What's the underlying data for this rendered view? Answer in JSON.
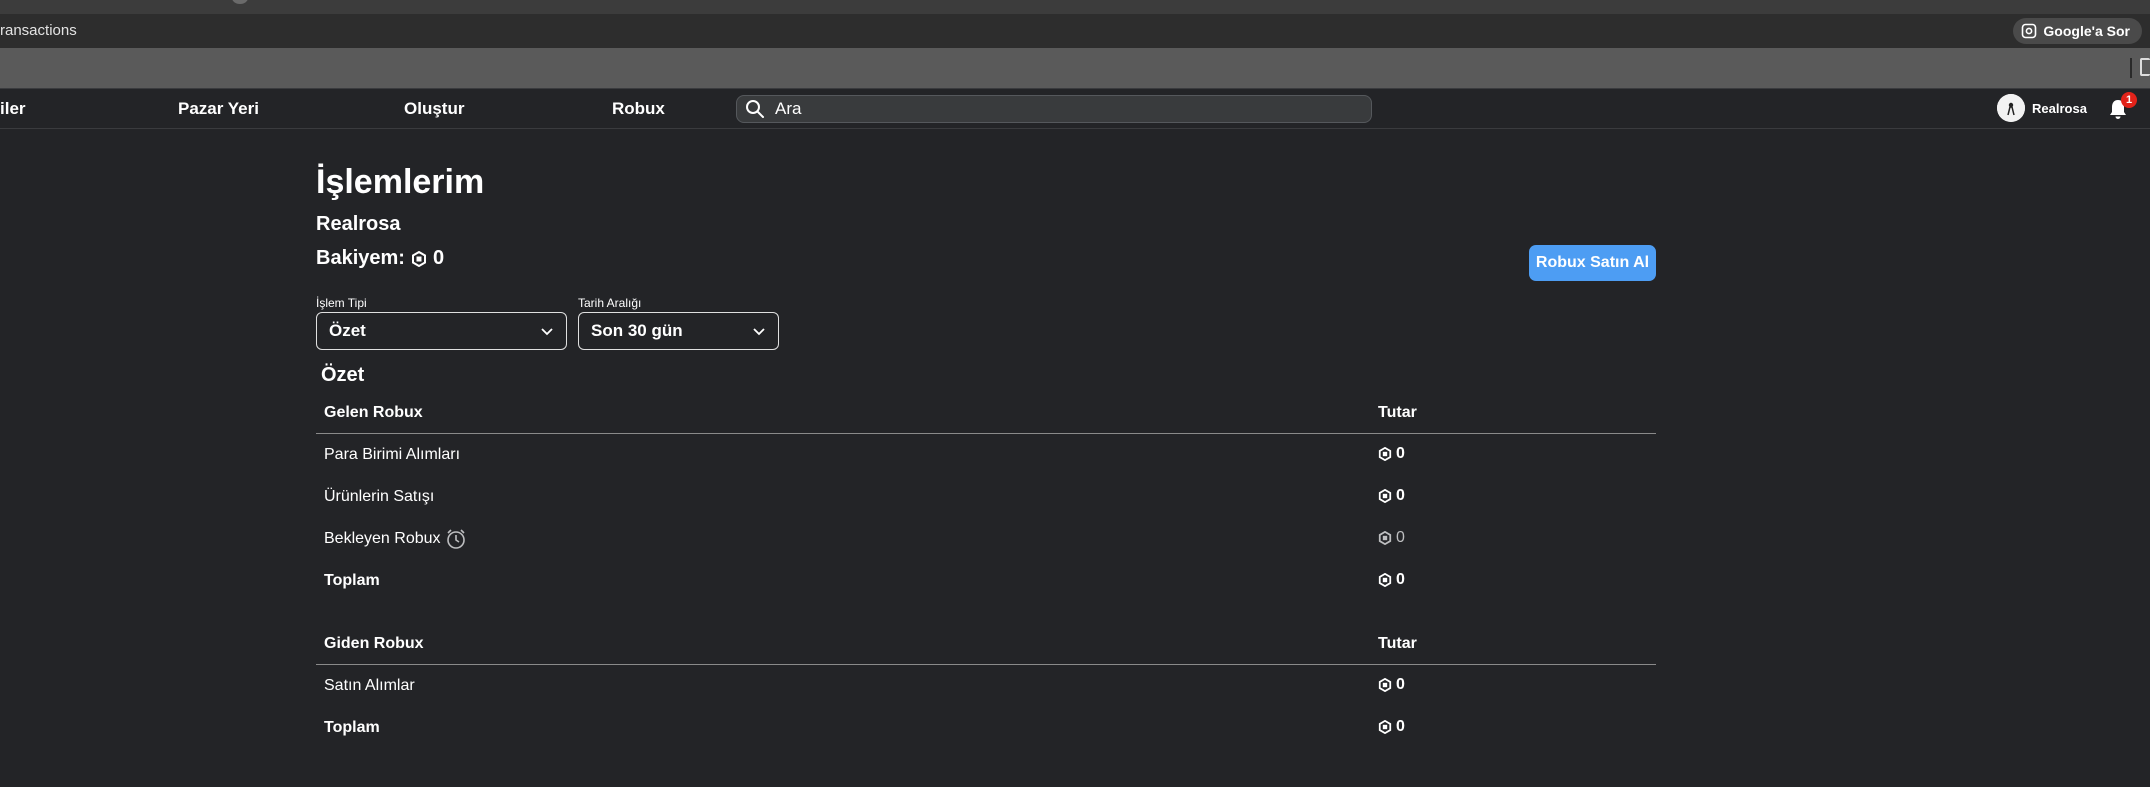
{
  "browser": {
    "url_fragment": "ransactions",
    "google_ask_label": "Google'a Sor"
  },
  "nav": {
    "items": [
      "iler",
      "Pazar Yeri",
      "Oluştur",
      "Robux"
    ],
    "search_placeholder": "Ara",
    "username": "Realrosa",
    "notification_count": "1"
  },
  "page": {
    "title": "İşlemlerim",
    "account_name": "Realrosa",
    "balance_label": "Bakiyem:",
    "balance_value": "0",
    "buy_button": "Robux Satın Al"
  },
  "filters": {
    "type_label": "İşlem Tipi",
    "type_value": "Özet",
    "range_label": "Tarih Aralığı",
    "range_value": "Son 30 gün"
  },
  "summary": {
    "title": "Özet",
    "incoming": {
      "header": "Gelen Robux",
      "amount_header": "Tutar",
      "rows": [
        {
          "label": "Para Birimi Alımları",
          "value": "0"
        },
        {
          "label": "Ürünlerin Satışı",
          "value": "0"
        },
        {
          "label": "Bekleyen Robux",
          "value": "0"
        },
        {
          "label": "Toplam",
          "value": "0"
        }
      ]
    },
    "outgoing": {
      "header": "Giden Robux",
      "amount_header": "Tutar",
      "rows": [
        {
          "label": "Satın Alımlar",
          "value": "0"
        },
        {
          "label": "Toplam",
          "value": "0"
        }
      ]
    }
  },
  "colors": {
    "background": "#232427",
    "accent_button": "#4d9df3",
    "badge": "#e2231a"
  }
}
